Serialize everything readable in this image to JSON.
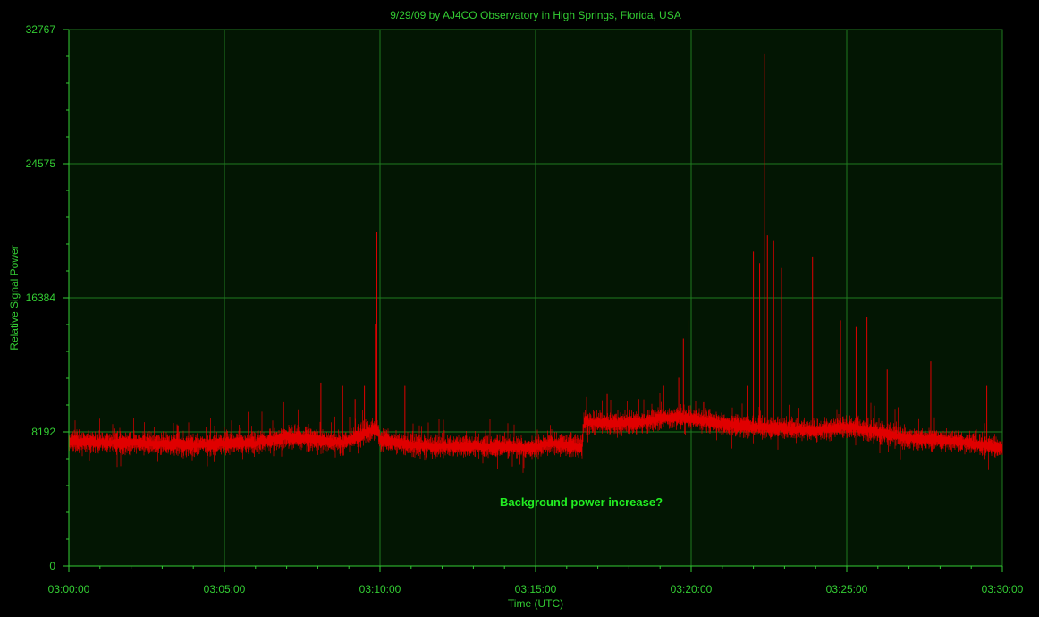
{
  "chart_data": {
    "type": "line",
    "title": "9/29/09  by  AJ4CO Observatory  in  High Springs, Florida, USA",
    "xlabel": "Time (UTC)",
    "ylabel": "Relative Signal Power",
    "xlim_minutes": [
      0,
      30
    ],
    "ylim": [
      0,
      32767
    ],
    "x_tick_labels": [
      "03:00:00",
      "03:05:00",
      "03:10:00",
      "03:15:00",
      "03:20:00",
      "03:25:00",
      "03:30:00"
    ],
    "y_tick_labels": [
      "0",
      "8192",
      "16384",
      "24575",
      "32767"
    ],
    "annotation": "Background power increase?",
    "grid": true,
    "colors": {
      "background": "#000000",
      "plot_background": "#031603",
      "grid": "#1f7a1f",
      "text": "#33cc33",
      "series": "#e00000",
      "annotation": "#22ee22"
    },
    "series": [
      {
        "baseline": [
          [
            0,
            7600
          ],
          [
            2,
            7500
          ],
          [
            4,
            7400
          ],
          [
            6,
            7500
          ],
          [
            7,
            7900
          ],
          [
            8,
            7700
          ],
          [
            8.8,
            7500
          ],
          [
            9.5,
            8100
          ],
          [
            9.9,
            8400
          ],
          [
            10,
            7700
          ],
          [
            11,
            7400
          ],
          [
            12,
            7300
          ],
          [
            13,
            7300
          ],
          [
            14,
            7300
          ],
          [
            14.8,
            7200
          ],
          [
            15.5,
            7500
          ],
          [
            16.5,
            7300
          ],
          [
            16.55,
            8800
          ],
          [
            17.5,
            8700
          ],
          [
            18.5,
            8800
          ],
          [
            19,
            9000
          ],
          [
            19.5,
            9100
          ],
          [
            20,
            9000
          ],
          [
            21,
            8700
          ],
          [
            22,
            8500
          ],
          [
            23,
            8400
          ],
          [
            24,
            8300
          ],
          [
            25,
            8500
          ],
          [
            26,
            8200
          ],
          [
            27,
            7800
          ],
          [
            28,
            7700
          ],
          [
            29,
            7500
          ],
          [
            30,
            7200
          ]
        ],
        "noise_amplitude": 500,
        "spikes": [
          [
            6.9,
            10000
          ],
          [
            8.1,
            11200
          ],
          [
            8.8,
            11000
          ],
          [
            9.2,
            10200
          ],
          [
            9.5,
            11000
          ],
          [
            9.85,
            14800
          ],
          [
            9.9,
            20400
          ],
          [
            10.8,
            11000
          ],
          [
            17.3,
            10500
          ],
          [
            19.6,
            11500
          ],
          [
            19.75,
            13900
          ],
          [
            19.9,
            15000
          ],
          [
            20.4,
            10000
          ],
          [
            21.8,
            11000
          ],
          [
            22.0,
            19200
          ],
          [
            22.2,
            18500
          ],
          [
            22.35,
            31300
          ],
          [
            22.45,
            20200
          ],
          [
            22.65,
            19900
          ],
          [
            22.9,
            18200
          ],
          [
            23.9,
            18900
          ],
          [
            24.8,
            15000
          ],
          [
            25.3,
            14600
          ],
          [
            25.65,
            15200
          ],
          [
            26.3,
            12000
          ],
          [
            27.7,
            12500
          ],
          [
            29.5,
            11000
          ]
        ]
      }
    ]
  }
}
